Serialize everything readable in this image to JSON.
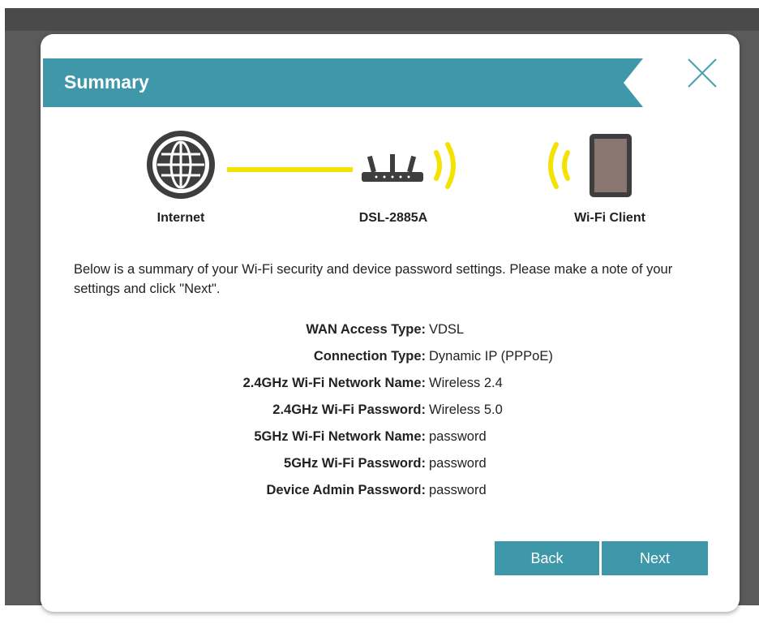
{
  "dialog": {
    "title": "Summary",
    "close_icon": "close-x-icon",
    "accent_color": "#3f98a9",
    "signal_color": "#f4e300"
  },
  "diagram": {
    "internet_label": "Internet",
    "router_label": "DSL-2885A",
    "client_label": "Wi-Fi Client"
  },
  "intro_text": "Below is a summary of your Wi-Fi security and device password settings. Please make a note of your settings and click \"Next\".",
  "summary": [
    {
      "key": "WAN Access Type:",
      "value": "VDSL"
    },
    {
      "key": "Connection Type:",
      "value": "Dynamic IP (PPPoE)"
    },
    {
      "key": "2.4GHz Wi-Fi Network Name:",
      "value": "Wireless 2.4"
    },
    {
      "key": "2.4GHz Wi-Fi Password:",
      "value": "Wireless 5.0"
    },
    {
      "key": "5GHz Wi-Fi Network Name:",
      "value": "password"
    },
    {
      "key": "5GHz Wi-Fi Password:",
      "value": "password"
    },
    {
      "key": "Device Admin Password:",
      "value": "password"
    }
  ],
  "buttons": {
    "back_label": "Back",
    "next_label": "Next"
  }
}
